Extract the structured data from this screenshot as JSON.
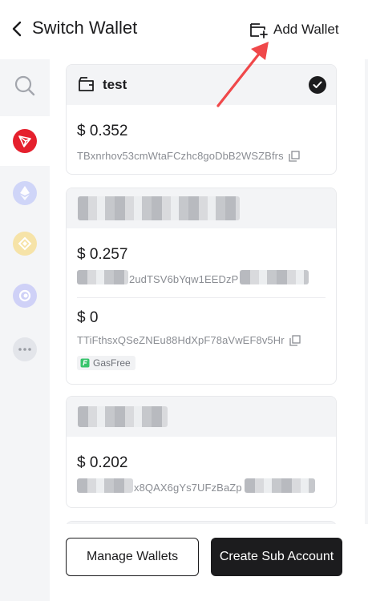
{
  "header": {
    "title": "Switch Wallet",
    "add_wallet_label": "Add Wallet"
  },
  "sidebar": {
    "items": [
      {
        "name": "search",
        "active": false
      },
      {
        "name": "tron",
        "color": "#e5202d",
        "active": true
      },
      {
        "name": "ethereum",
        "color": "#cfd5f8",
        "active": false
      },
      {
        "name": "bnb",
        "color": "#f6e3a8",
        "active": false
      },
      {
        "name": "other-chain",
        "color": "#cfd1f7",
        "active": false
      },
      {
        "name": "more",
        "active": false
      }
    ]
  },
  "wallets": [
    {
      "name": "test",
      "selected": true,
      "accounts": [
        {
          "balance": "$ 0.352",
          "address": "TBxnrhov53cmWtaFCzhc8goDbB2WSZBfrs"
        }
      ]
    },
    {
      "name": "",
      "name_blurred": true,
      "accounts": [
        {
          "balance": "$ 0.257",
          "address": "2udTSV6bYqw1EEDzP",
          "address_partially_blurred": true
        },
        {
          "balance": "$ 0",
          "address": "TTiFthsxQSeZNEu88HdXpF78aVwEF8v5Hr",
          "badge": "GasFree"
        }
      ]
    },
    {
      "name": "",
      "name_blurred": true,
      "accounts": [
        {
          "balance": "$ 0.202",
          "address": "x8QAX6gYs7UFzBaZp",
          "address_partially_blurred": true
        }
      ]
    }
  ],
  "footer": {
    "manage_label": "Manage Wallets",
    "create_label": "Create Sub Account"
  },
  "annotation": {
    "arrow_color": "#f0484a"
  }
}
